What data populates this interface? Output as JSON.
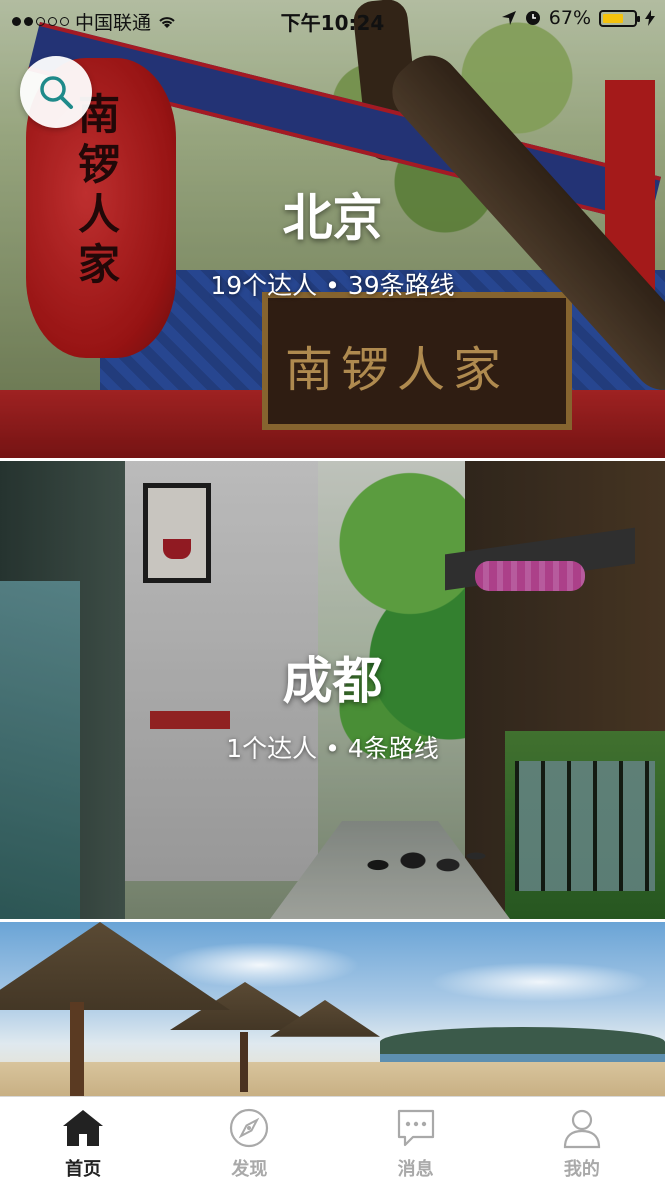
{
  "status_bar": {
    "carrier": "中国联通",
    "time": "下午10:24",
    "battery": "67%",
    "battery_level": 0.67,
    "battery_color": "#f4c20d"
  },
  "search": {
    "icon": "search-icon",
    "icon_color": "#1f8a8a"
  },
  "cities": [
    {
      "name": "北京",
      "stats": "19个达人 • 39条路线",
      "scene": "beijing-gate",
      "plaque_text": "南锣人家",
      "lantern_text": "南锣人家"
    },
    {
      "name": "成都",
      "stats": "1个达人 • 4条路线",
      "scene": "chengdu-street"
    },
    {
      "name": "",
      "stats": "",
      "scene": "tropical-beach"
    }
  ],
  "tab_bar": {
    "tabs": [
      {
        "label": "首页",
        "icon": "home-icon",
        "active": true
      },
      {
        "label": "发现",
        "icon": "compass-icon",
        "active": false
      },
      {
        "label": "消息",
        "icon": "message-icon",
        "active": false
      },
      {
        "label": "我的",
        "icon": "profile-icon",
        "active": false
      }
    ],
    "active_color": "#222222",
    "inactive_color": "#a9a9a9"
  }
}
